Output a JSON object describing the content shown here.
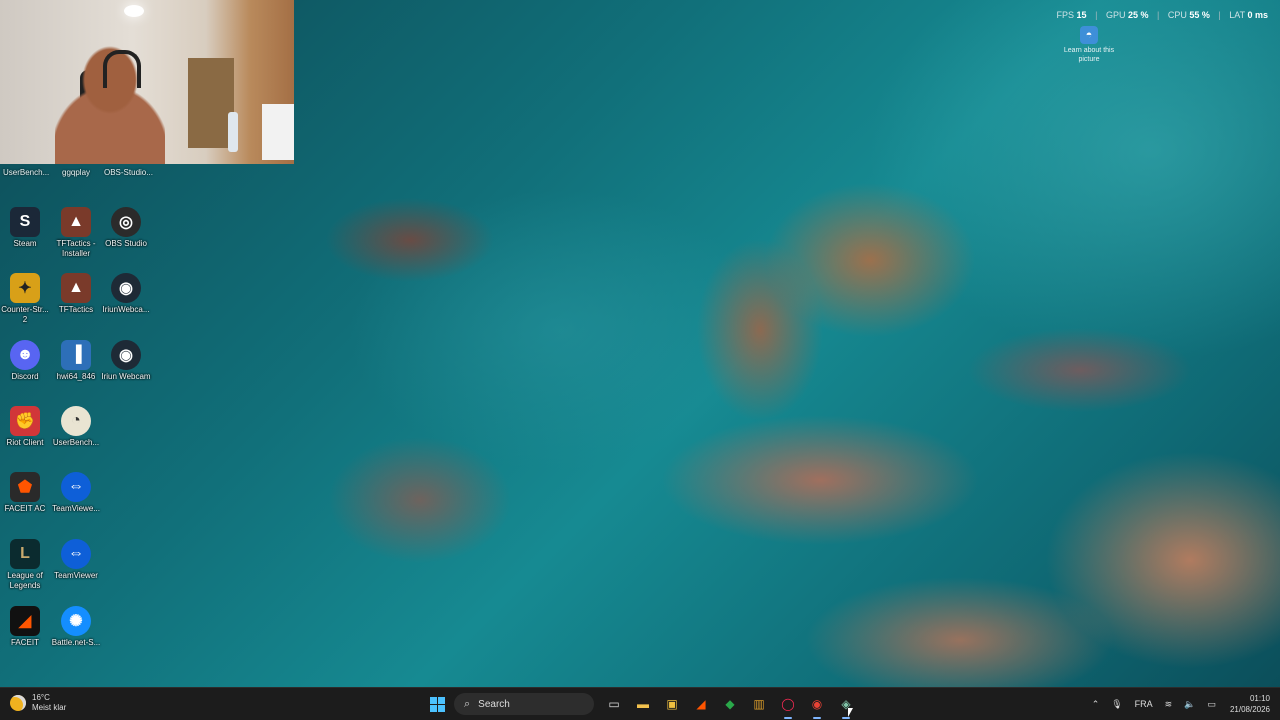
{
  "overlay": {
    "fps_label": "FPS",
    "fps_value": "15",
    "gpu_label": "GPU",
    "gpu_value": "25 %",
    "cpu_label": "CPU",
    "cpu_value": "55 %",
    "lat_label": "LAT",
    "lat_value": "0 ms"
  },
  "learn_picture": {
    "label": "Learn about this picture"
  },
  "cut_labels": [
    "UserBench...",
    "ggqplay",
    "OBS-Studio..."
  ],
  "desktop_icons": [
    {
      "label": "Steam",
      "icon": "steam-icon",
      "color": "#1b2838"
    },
    {
      "label": "TFTactics - Installer",
      "icon": "tftactics-icon",
      "color": "#7a3a2a"
    },
    {
      "label": "OBS Studio",
      "icon": "obs-icon",
      "color": "#2b2b2b"
    },
    {
      "label": "Counter-Str... 2",
      "icon": "counter-strike-icon",
      "color": "#d8a018"
    },
    {
      "label": "TFTactics",
      "icon": "tftactics-icon",
      "color": "#7a3a2a"
    },
    {
      "label": "IriunWebca...",
      "icon": "iriun-icon",
      "color": "#1e2a36"
    },
    {
      "label": "Discord",
      "icon": "discord-icon",
      "color": "#5865f2"
    },
    {
      "label": "hwi64_846",
      "icon": "hwinfo-icon",
      "color": "#2d6fb8"
    },
    {
      "label": "Iriun Webcam",
      "icon": "iriun-icon",
      "color": "#1e2a36"
    },
    {
      "label": "Riot Client",
      "icon": "riot-icon",
      "color": "#d13639"
    },
    {
      "label": "UserBench...",
      "icon": "userbenchmark-icon",
      "color": "#e9e4d2"
    },
    {
      "label": "FACEIT AC",
      "icon": "faceit-ac-icon",
      "color": "#2a2a2a"
    },
    {
      "label": "TeamViewe...",
      "icon": "teamviewer-icon",
      "color": "#0e5fd8"
    },
    {
      "label": "League of Legends",
      "icon": "league-icon",
      "color": "#0b2b2f"
    },
    {
      "label": "TeamViewer",
      "icon": "teamviewer-icon",
      "color": "#0e5fd8"
    },
    {
      "label": "FACEIT",
      "icon": "faceit-icon",
      "color": "#111111"
    },
    {
      "label": "Battle.net-S...",
      "icon": "battlenet-icon",
      "color": "#148eff"
    }
  ],
  "taskbar": {
    "weather_temp": "16°C",
    "weather_desc": "Meist klar",
    "search_placeholder": "Search",
    "apps": [
      {
        "name": "task-view-icon",
        "glyph": "▭",
        "color": "#dddddd"
      },
      {
        "name": "file-explorer-icon",
        "glyph": "▬",
        "color": "#f2c14e"
      },
      {
        "name": "store-icon",
        "glyph": "▣",
        "color": "#f0c040"
      },
      {
        "name": "faceit-taskbar-icon",
        "glyph": "◢",
        "color": "#ff5500"
      },
      {
        "name": "xbox-icon",
        "glyph": "◆",
        "color": "#2aa84a"
      },
      {
        "name": "winrar-icon",
        "glyph": "▥",
        "color": "#d89a2a"
      },
      {
        "name": "opera-gx-icon",
        "glyph": "◯",
        "color": "#ff2a55"
      },
      {
        "name": "chrome-icon",
        "glyph": "◉",
        "color": "#e94235"
      },
      {
        "name": "app-active-icon",
        "glyph": "◈",
        "color": "#7fc4a8"
      }
    ],
    "language": "FRA",
    "time": "01:10",
    "date": "21/08/2026"
  }
}
